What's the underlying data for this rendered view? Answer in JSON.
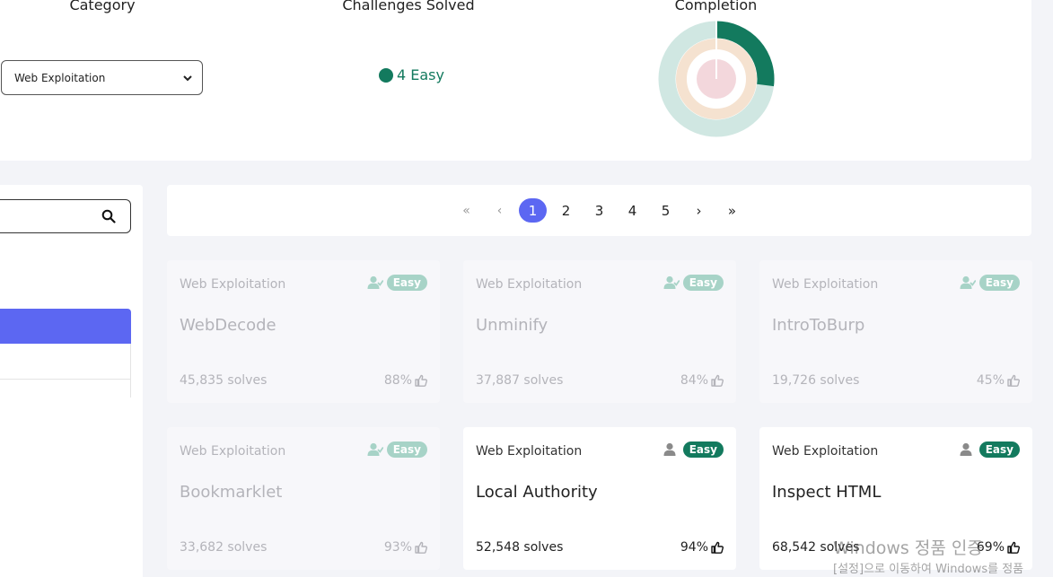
{
  "stats": {
    "category_heading": "Category",
    "solved_heading": "Challenges Solved",
    "completion_heading": "Completion",
    "category_selected": "Web Exploitation",
    "solved_count_label": "4 Easy",
    "completion": {
      "outer_fraction": 0.27,
      "colors": {
        "outer_fill": "#137a5e",
        "outer_track": "#d0e7e2",
        "middle": "#f5e2d0",
        "inner": "#f3d7dc"
      }
    }
  },
  "pagination": {
    "first": "«",
    "prev": "‹",
    "pages": [
      "1",
      "2",
      "3",
      "4",
      "5"
    ],
    "active_page": "1",
    "next": "›",
    "last": "»"
  },
  "challenges": [
    {
      "category": "Web Exploitation",
      "name": "WebDecode",
      "solves": "45,835 solves",
      "likes": "88%",
      "difficulty": "Easy",
      "solved": true
    },
    {
      "category": "Web Exploitation",
      "name": "Unminify",
      "solves": "37,887 solves",
      "likes": "84%",
      "difficulty": "Easy",
      "solved": true
    },
    {
      "category": "Web Exploitation",
      "name": "IntroToBurp",
      "solves": "19,726 solves",
      "likes": "45%",
      "difficulty": "Easy",
      "solved": true
    },
    {
      "category": "Web Exploitation",
      "name": "Bookmarklet",
      "solves": "33,682 solves",
      "likes": "93%",
      "difficulty": "Easy",
      "solved": true
    },
    {
      "category": "Web Exploitation",
      "name": "Local Authority",
      "solves": "52,548 solves",
      "likes": "94%",
      "difficulty": "Easy",
      "solved": false
    },
    {
      "category": "Web Exploitation",
      "name": "Inspect HTML",
      "solves": "68,542 solves",
      "likes": "69%",
      "difficulty": "Easy",
      "solved": false
    }
  ],
  "overlay": {
    "watermark_line1": "Windows 정품 인증",
    "watermark_line2": "[설정]으로 이동하여 Windows를 정품"
  },
  "icons": {
    "search": "search-icon",
    "dropdown": "chevron-down-icon",
    "thumb": "thumbs-up-icon",
    "solved_user": "user-check-icon",
    "user": "user-icon"
  }
}
